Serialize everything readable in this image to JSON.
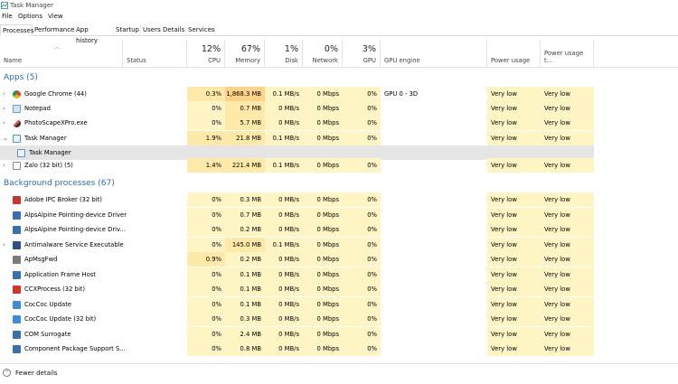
{
  "window": {
    "title": "Task Manager"
  },
  "menu": [
    "File",
    "Options",
    "View"
  ],
  "tabs": [
    "Processes",
    "Performance",
    "App history",
    "Startup",
    "Users",
    "Details",
    "Services"
  ],
  "columns": {
    "name": "Name",
    "status": "Status",
    "cpu": {
      "pct": "12%",
      "label": "CPU"
    },
    "memory": {
      "pct": "67%",
      "label": "Memory"
    },
    "disk": {
      "pct": "1%",
      "label": "Disk"
    },
    "network": {
      "pct": "0%",
      "label": "Network"
    },
    "gpu": {
      "pct": "3%",
      "label": "GPU"
    },
    "gpu_engine": "GPU engine",
    "power": "Power usage",
    "power_trend": "Power usage t..."
  },
  "groups": {
    "apps": "Apps (5)",
    "background": "Background processes (67)"
  },
  "apps": [
    {
      "name": "Google Chrome (44)",
      "cpu": "0.3%",
      "mem": "1,868.3 MB",
      "disk": "0.1 MB/s",
      "net": "0 Mbps",
      "gpu": "0%",
      "engine": "GPU 0 - 3D",
      "power": "Very low",
      "trend": "Very low"
    },
    {
      "name": "Notepad",
      "cpu": "0%",
      "mem": "0.7 MB",
      "disk": "0 MB/s",
      "net": "0 Mbps",
      "gpu": "0%",
      "engine": "",
      "power": "Very low",
      "trend": "Very low"
    },
    {
      "name": "PhotoScapeXPro.exe",
      "cpu": "0%",
      "mem": "5.7 MB",
      "disk": "0 MB/s",
      "net": "0 Mbps",
      "gpu": "0%",
      "engine": "",
      "power": "Very low",
      "trend": "Very low"
    },
    {
      "name": "Task Manager",
      "cpu": "1.9%",
      "mem": "21.8 MB",
      "disk": "0.1 MB/s",
      "net": "0 Mbps",
      "gpu": "0%",
      "engine": "",
      "power": "Very low",
      "trend": "Very low"
    },
    {
      "name": "Zalo (32 bit) (5)",
      "cpu": "1.4%",
      "mem": "221.4 MB",
      "disk": "0.1 MB/s",
      "net": "0 Mbps",
      "gpu": "0%",
      "engine": "",
      "power": "Very low",
      "trend": "Very low"
    }
  ],
  "task_manager_child": "Task Manager",
  "background": [
    {
      "name": "Adobe IPC Broker (32 bit)",
      "cpu": "0%",
      "mem": "0.3 MB",
      "disk": "0 MB/s",
      "net": "0 Mbps",
      "gpu": "0%",
      "power": "Very low",
      "trend": "Very low"
    },
    {
      "name": "AlpsAlpine Pointing-device Driver",
      "cpu": "0%",
      "mem": "0.7 MB",
      "disk": "0 MB/s",
      "net": "0 Mbps",
      "gpu": "0%",
      "power": "Very low",
      "trend": "Very low"
    },
    {
      "name": "AlpsAlpine Pointing-device Driv...",
      "cpu": "0%",
      "mem": "0.2 MB",
      "disk": "0 MB/s",
      "net": "0 Mbps",
      "gpu": "0%",
      "power": "Very low",
      "trend": "Very low"
    },
    {
      "name": "Antimalware Service Executable",
      "cpu": "0%",
      "mem": "145.0 MB",
      "disk": "0.1 MB/s",
      "net": "0 Mbps",
      "gpu": "0%",
      "power": "Very low",
      "trend": "Very low"
    },
    {
      "name": "ApMsgFwd",
      "cpu": "0.9%",
      "mem": "0.2 MB",
      "disk": "0 MB/s",
      "net": "0 Mbps",
      "gpu": "0%",
      "power": "Very low",
      "trend": "Very low"
    },
    {
      "name": "Application Frame Host",
      "cpu": "0%",
      "mem": "0.1 MB",
      "disk": "0 MB/s",
      "net": "0 Mbps",
      "gpu": "0%",
      "power": "Very low",
      "trend": "Very low"
    },
    {
      "name": "CCXProcess (32 bit)",
      "cpu": "0%",
      "mem": "0.1 MB",
      "disk": "0 MB/s",
      "net": "0 Mbps",
      "gpu": "0%",
      "power": "Very low",
      "trend": "Very low"
    },
    {
      "name": "CocCoc Update",
      "cpu": "0%",
      "mem": "0.1 MB",
      "disk": "0 MB/s",
      "net": "0 Mbps",
      "gpu": "0%",
      "power": "Very low",
      "trend": "Very low"
    },
    {
      "name": "CocCoc Update (32 bit)",
      "cpu": "0%",
      "mem": "0.3 MB",
      "disk": "0 MB/s",
      "net": "0 Mbps",
      "gpu": "0%",
      "power": "Very low",
      "trend": "Very low"
    },
    {
      "name": "COM Surrogate",
      "cpu": "0%",
      "mem": "2.4 MB",
      "disk": "0 MB/s",
      "net": "0 Mbps",
      "gpu": "0%",
      "power": "Very low",
      "trend": "Very low"
    },
    {
      "name": "Component Package Support S...",
      "cpu": "0%",
      "mem": "0.8 MB",
      "disk": "0 MB/s",
      "net": "0 Mbps",
      "gpu": "0%",
      "power": "Very low",
      "trend": "Very low"
    }
  ],
  "footer": {
    "fewer_details": "Fewer details"
  }
}
